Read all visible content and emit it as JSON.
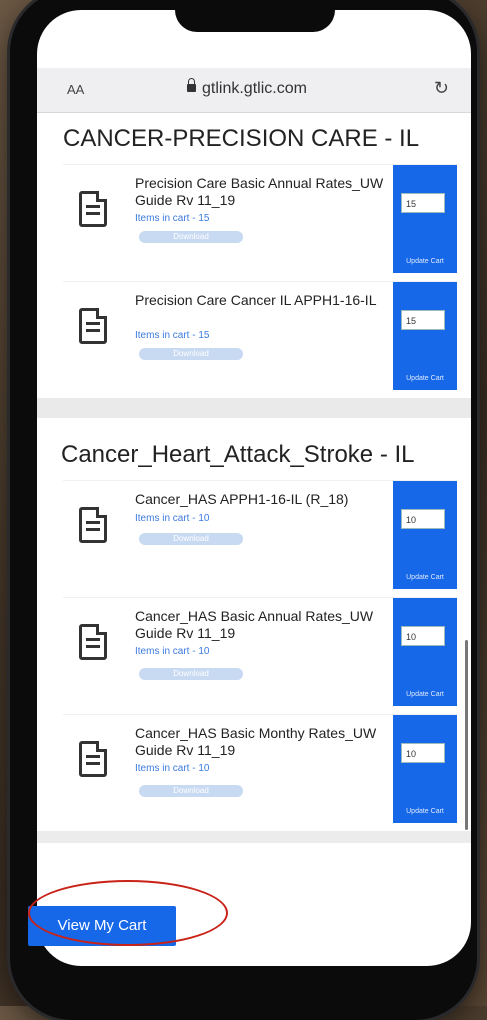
{
  "browser": {
    "aa_label": "AA",
    "url": "gtlink.gtlic.com",
    "reload_icon": "reload-icon"
  },
  "sections": [
    {
      "title": "CANCER-PRECISION CARE - IL",
      "items": [
        {
          "name": "Precision Care Basic Annual Rates_UW Guide Rv 11_19",
          "count": "Items in cart - 15",
          "qty": "15",
          "download_label": "Download",
          "update_label": "Update Cart"
        },
        {
          "name": "Precision Care Cancer IL APPH1-16-IL",
          "count": "Items in cart - 15",
          "qty": "15",
          "download_label": "Download",
          "update_label": "Update Cart"
        }
      ]
    },
    {
      "title": "Cancer_Heart_Attack_Stroke - IL",
      "items": [
        {
          "name": "Cancer_HAS APPH1-16-IL (R_18)",
          "count": "Items in cart - 10",
          "qty": "10",
          "download_label": "Download",
          "update_label": "Update Cart"
        },
        {
          "name": "Cancer_HAS Basic Annual Rates_UW Guide Rv 11_19",
          "count": "Items in cart - 10",
          "qty": "10",
          "download_label": "Download",
          "update_label": "Update Cart"
        },
        {
          "name": "Cancer_HAS Basic Monthy Rates_UW Guide Rv 11_19",
          "count": "Items in cart - 10",
          "qty": "10",
          "download_label": "Download",
          "update_label": "Update Cart"
        }
      ]
    }
  ],
  "view_cart_label": "View My Cart",
  "colors": {
    "accent": "#1668e8",
    "highlight": "#c92318"
  }
}
